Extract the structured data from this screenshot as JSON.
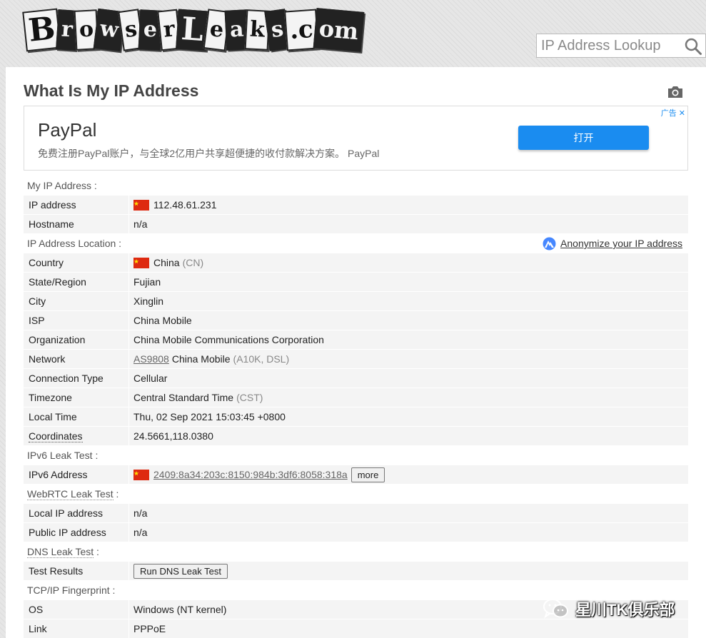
{
  "header": {
    "logo_text": "BrowserLeaks.com",
    "search": {
      "placeholder": "IP Address Lookup"
    }
  },
  "page": {
    "title": "What Is My IP Address"
  },
  "ad": {
    "title": "PayPal",
    "description": "免费注册PayPal账户，与全球2亿用户共享超便捷的收付款解决方案。 PayPal",
    "button_label": "打开",
    "badge": "广告",
    "accent_color": "#1a8cf0"
  },
  "sections": {
    "my_ip": {
      "heading": "My IP Address :",
      "ip_label": "IP address",
      "ip_value": "112.48.61.231",
      "hostname_label": "Hostname",
      "hostname_value": "n/a"
    },
    "location": {
      "heading": "IP Address Location :",
      "anonymize_link": "Anonymize your IP address",
      "country_label": "Country",
      "country_value": "China",
      "country_code": "(CN)",
      "state_label": "State/Region",
      "state_value": "Fujian",
      "city_label": "City",
      "city_value": "Xinglin",
      "isp_label": "ISP",
      "isp_value": "China Mobile",
      "org_label": "Organization",
      "org_value": "China Mobile Communications Corporation",
      "network_label": "Network",
      "network_as": "AS9808",
      "network_name": "China Mobile",
      "network_extra": "(A10K, DSL)",
      "conn_label": "Connection Type",
      "conn_value": "Cellular",
      "tz_label": "Timezone",
      "tz_value": "Central Standard Time",
      "tz_abbr": "(CST)",
      "time_label": "Local Time",
      "time_value": "Thu, 02 Sep 2021 15:03:45 +0800",
      "coords_label": "Coordinates",
      "coords_value": "24.5661,118.0380"
    },
    "ipv6": {
      "heading": "IPv6 Leak Test :",
      "addr_label": "IPv6 Address",
      "addr_value": "2409:8a34:203c:8150:984b:3df6:8058:318a",
      "more_label": "more"
    },
    "webrtc": {
      "heading_link": "WebRTC Leak Test",
      "heading_suffix": " :",
      "local_label": "Local IP address",
      "local_value": "n/a",
      "public_label": "Public IP address",
      "public_value": "n/a"
    },
    "dns": {
      "heading_link": "DNS Leak Test",
      "heading_suffix": " :",
      "results_label": "Test Results",
      "run_button": "Run DNS Leak Test"
    },
    "tcpip": {
      "heading": "TCP/IP Fingerprint :",
      "os_label": "OS",
      "os_value": "Windows (NT kernel)",
      "link_label": "Link",
      "link_value": "PPPoE"
    }
  },
  "watermark": {
    "text": "星川TK俱乐部"
  },
  "colors": {
    "row_bg": "#f4f4f4",
    "flag_red": "#de2910",
    "flag_star": "#ffde00"
  }
}
